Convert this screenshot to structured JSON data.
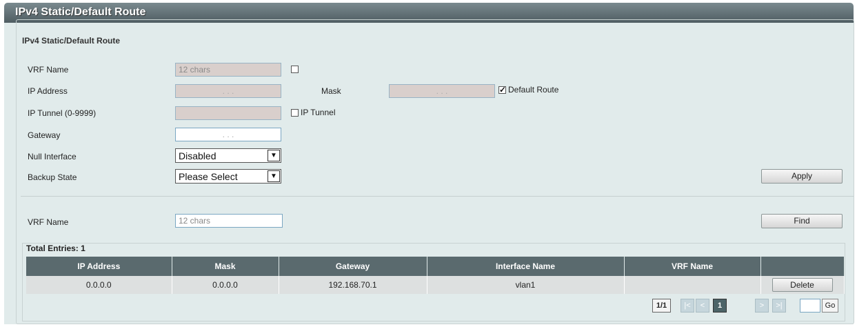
{
  "page": {
    "title": "IPv4 Static/Default Route"
  },
  "section": {
    "legend": "IPv4 Static/Default Route"
  },
  "form": {
    "vrf_name_label": "VRF Name",
    "vrf_name_placeholder": "12 chars",
    "ip_address_label": "IP Address",
    "ip_mask_dots": ".  .  .",
    "mask_label": "Mask",
    "default_route_label": "Default Route",
    "default_route_checked": true,
    "ip_tunnel_label": "IP Tunnel (0-9999)",
    "ip_tunnel_check_label": "IP Tunnel",
    "gateway_label": "Gateway",
    "null_interface_label": "Null Interface",
    "null_interface_value": "Disabled",
    "backup_state_label": "Backup State",
    "backup_state_value": "Please Select",
    "apply_label": "Apply"
  },
  "search": {
    "vrf_name_label": "VRF Name",
    "vrf_name_placeholder": "12 chars",
    "find_label": "Find"
  },
  "table": {
    "total_entries": "Total Entries: 1",
    "headers": [
      "IP Address",
      "Mask",
      "Gateway",
      "Interface Name",
      "VRF Name",
      ""
    ],
    "rows": [
      {
        "ip": "0.0.0.0",
        "mask": "0.0.0.0",
        "gateway": "192.168.70.1",
        "interface": "vlan1",
        "vrf": "",
        "action": "Delete"
      }
    ]
  },
  "pagination": {
    "page_info": "1/1",
    "first": "|<",
    "prev": "<",
    "current": "1",
    "next": ">",
    "last": ">|",
    "go_label": "Go"
  }
}
